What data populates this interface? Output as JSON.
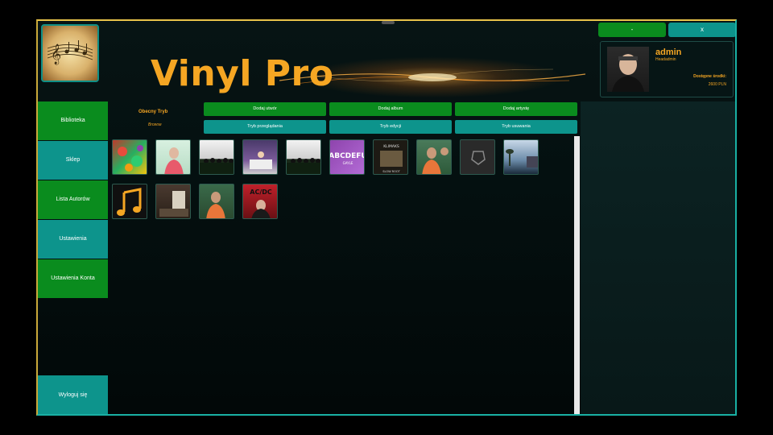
{
  "app": {
    "title": "Vinyl Pro"
  },
  "window_controls": {
    "minimize": "-",
    "close": "x"
  },
  "user": {
    "name": "admin",
    "role": "Headadmin",
    "funds_label": "Dostępne środki:",
    "funds_value": "2600 PLN"
  },
  "sidebar": {
    "items": [
      {
        "label": "Biblioteka",
        "color": "#0a8c1e"
      },
      {
        "label": "Sklep",
        "color": "#0d948c"
      },
      {
        "label": "Lista Autorów",
        "color": "#0a8c1e"
      },
      {
        "label": "Ustawienia",
        "color": "#0d948c"
      },
      {
        "label": "Ustawienia Konta",
        "color": "#0a8c1e"
      }
    ],
    "logout": "Wyloguj się"
  },
  "mode": {
    "label": "Obecny Tryb",
    "value": "Browse"
  },
  "actions": {
    "add_song": "Dodaj utwór",
    "add_album": "Dodaj album",
    "add_artist": "Dodaj artystę",
    "view_mode": "Tryb przeglądania",
    "edit_mode": "Tryb edycji",
    "delete_mode": "Tryb usuwania"
  },
  "albums": [
    {
      "name": "album-cover-1"
    },
    {
      "name": "album-cover-2"
    },
    {
      "name": "album-cover-3"
    },
    {
      "name": "album-cover-4"
    },
    {
      "name": "album-cover-5"
    },
    {
      "name": "album-cover-abcdefu",
      "cover_text": "ABCDEFU",
      "cover_subtext": "GAYLE"
    },
    {
      "name": "album-cover-7",
      "cover_text": "KLIMAKS",
      "cover_subtext": "SLOW ROOT"
    },
    {
      "name": "album-cover-8"
    },
    {
      "name": "album-cover-9"
    },
    {
      "name": "album-cover-10"
    },
    {
      "name": "album-cover-music-note"
    },
    {
      "name": "album-cover-12"
    },
    {
      "name": "album-cover-13"
    },
    {
      "name": "album-cover-acdc",
      "cover_text": "AC/DC"
    }
  ],
  "colors": {
    "accent": "#f5a623",
    "green": "#0a8c1e",
    "teal": "#0d948c"
  }
}
